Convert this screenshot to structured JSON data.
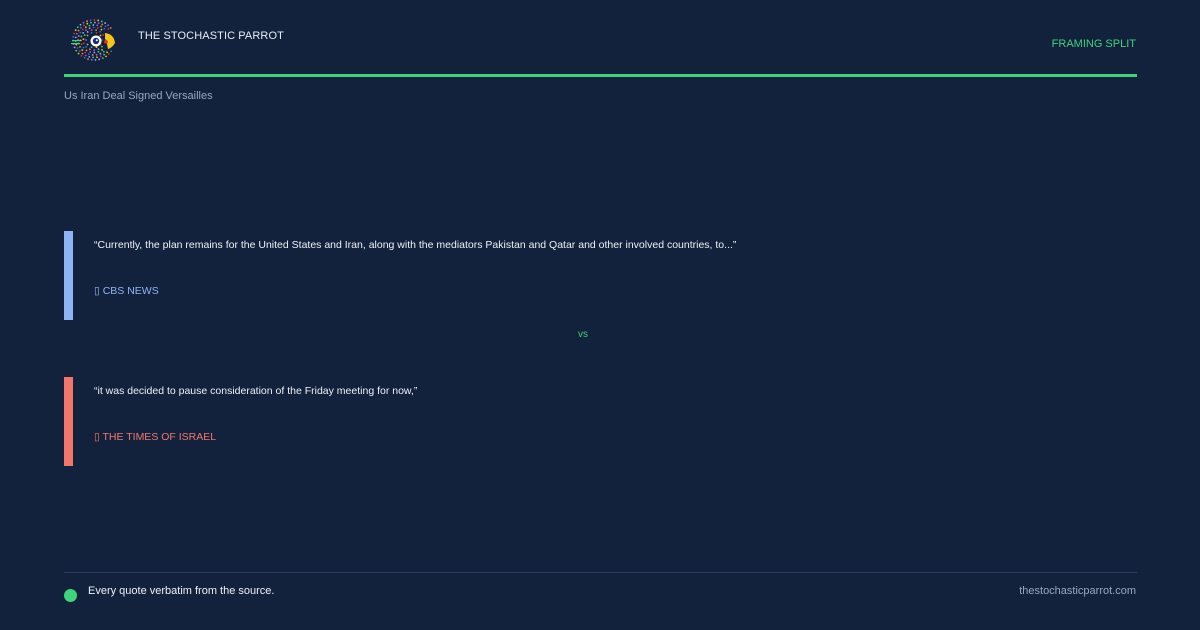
{
  "header": {
    "logo_icon": "parrot-logo-icon",
    "brand": "THE STOCHASTIC PARROT",
    "badge": "FRAMING SPLIT",
    "accent_color": "#3ed47a"
  },
  "topic": "Us Iran Deal Signed Versailles",
  "quotes": [
    {
      "text": "“Currently, the plan remains for the United States and Iran, along with the mediators Pakistan and Qatar and other involved countries, to...”",
      "source": "▯ CBS NEWS",
      "color": "#8fb4f6"
    },
    {
      "text": "“it was decided to pause consideration of the Friday meeting for now,”",
      "source": "▯ THE TIMES OF ISRAEL",
      "color": "#f2776a"
    }
  ],
  "vs_label": "vs",
  "footer": {
    "note": "Every quote verbatim from the source.",
    "site": "thestochasticparrot.com"
  }
}
